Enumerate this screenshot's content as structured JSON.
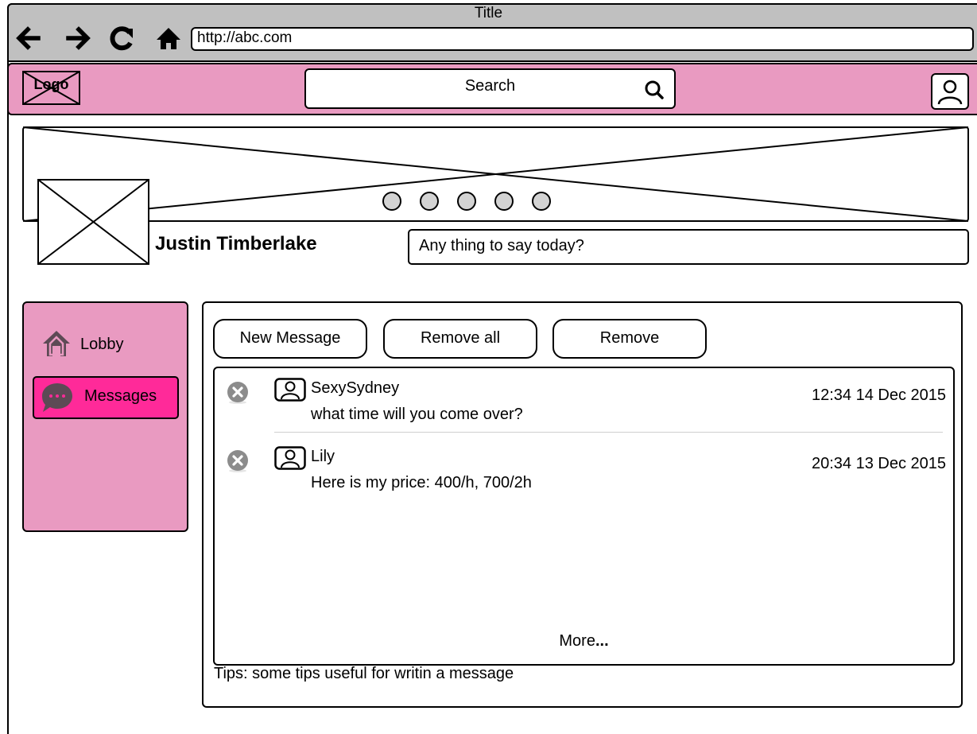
{
  "browser": {
    "title": "Title",
    "url": "http://abc.com",
    "nav_icons": [
      "back-arrow-icon",
      "forward-arrow-icon",
      "reload-icon",
      "home-icon"
    ]
  },
  "header": {
    "logo_text": "Logo",
    "search_label": "Search",
    "search_icon": "search-icon",
    "user_icon": "user-icon",
    "background": "#e99ac1"
  },
  "banner": {
    "carousel_dots": 5
  },
  "profile": {
    "name": "Justin Timberlake",
    "status_placeholder": "Any thing to say today?"
  },
  "sidebar": {
    "items": [
      {
        "label": "Lobby",
        "icon": "home-icon",
        "active": false
      },
      {
        "label": "Messages",
        "icon": "chat-bubble-icon",
        "active": true
      }
    ],
    "active_color": "#ff2a99"
  },
  "toolbar": {
    "new_message": "New Message",
    "remove_all": "Remove all",
    "remove": "Remove"
  },
  "messages": [
    {
      "sender": "SexySydney",
      "text": "what time will you come over?",
      "time": "12:34 14 Dec 2015"
    },
    {
      "sender": "Lily",
      "text": "Here is my price: 400/h, 700/2h",
      "time": "20:34 13 Dec 2015"
    }
  ],
  "more_label": "More",
  "more_ellipsis": "...",
  "tips": "Tips: some tips useful for writin a message"
}
